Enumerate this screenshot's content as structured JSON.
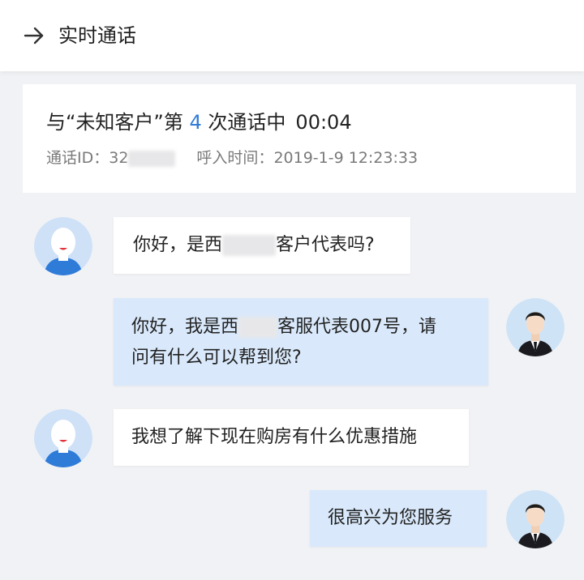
{
  "header": {
    "title": "实时通话"
  },
  "call": {
    "title_prefix": "与“未知客户”第 ",
    "count": "4",
    "title_suffix": " 次通话中",
    "timer": "00:04",
    "id_label": "通话ID：",
    "id_value_visible": "32",
    "time_label": "呼入时间：",
    "time_value": "2019-1-9 12:23:33"
  },
  "messages": [
    {
      "from": "customer",
      "before": "你好，是西",
      "after": "客户代表吗?"
    },
    {
      "from": "agent",
      "line1_before": "你好，我是西",
      "line1_after": "客服代表007号，请",
      "line2": "问有什么可以帮到您?"
    },
    {
      "from": "customer",
      "text": "我想了解下现在购房有什么优惠措施"
    },
    {
      "from": "agent",
      "text": "很高兴为您服务"
    }
  ],
  "colors": {
    "accent": "#2f7bd8",
    "agent_bubble": "#d9e9fb",
    "customer_avatar": "#8bb7ec",
    "agent_avatar": "#a9cdf2"
  },
  "icons": {
    "back": "arrow-right-icon",
    "customer_avatar": "customer-avatar-icon",
    "agent_avatar": "agent-avatar-icon"
  }
}
